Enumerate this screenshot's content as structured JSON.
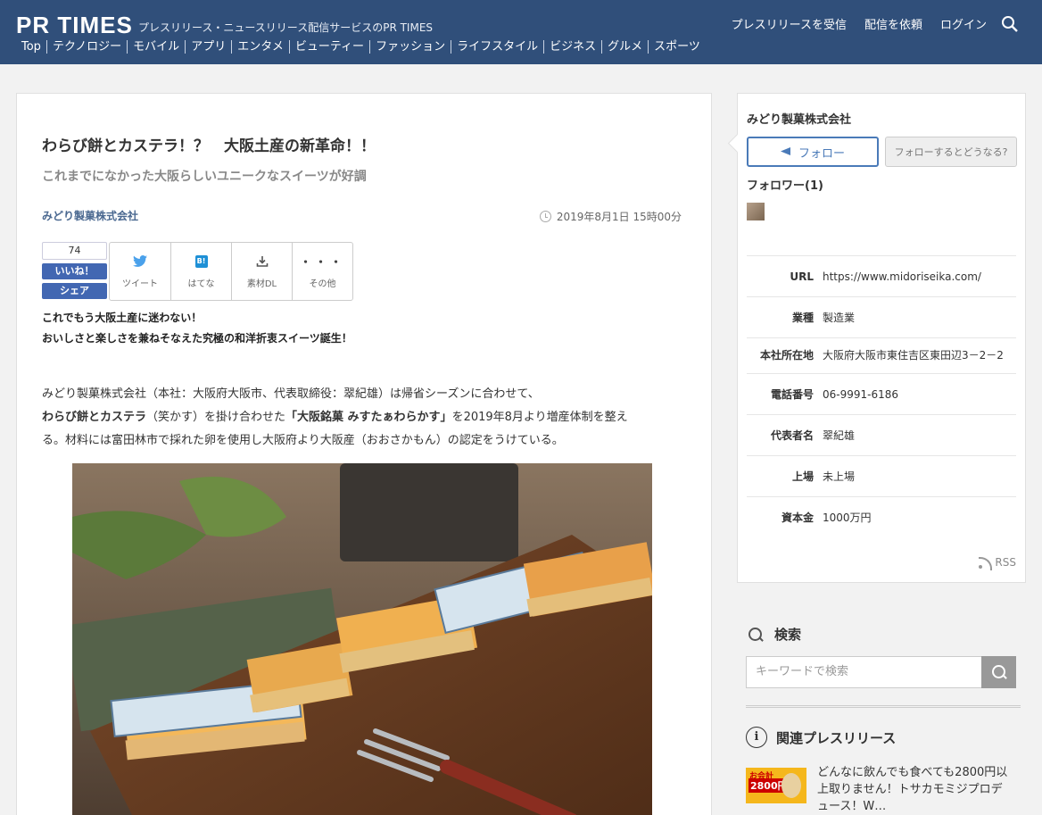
{
  "header": {
    "logo": "PR TIMES",
    "tagline": "プレスリリース・ニュースリリース配信サービスのPR TIMES",
    "links": [
      "プレスリリースを受信",
      "配信を依頼",
      "ログイン"
    ],
    "categories": [
      "Top",
      "テクノロジー",
      "モバイル",
      "アプリ",
      "エンタメ",
      "ビューティー",
      "ファッション",
      "ライフスタイル",
      "ビジネス",
      "グルメ",
      "スポーツ"
    ]
  },
  "article": {
    "title": "わらび餅とカステラ！？　大阪土産の新革命！！",
    "subtitle": "これまでになかった大阪らしいユニークなスイーツが好調",
    "company": "みどり製菓株式会社",
    "date": "2019年8月1日 15時00分",
    "lead1": "これでもう大阪土産に迷わない！",
    "lead2": "おいしさと楽しさを兼ねそなえた究極の和洋折衷スイーツ誕生！",
    "body1": "みどり製菓株式会社（本社：大阪府大阪市、代表取締役：翠紀雄）は帰省シーズンに合わせて、",
    "body2a": "わらび餅とカステラ",
    "body2b": "（笑かす）を掛け合わせた",
    "body2c": "「大阪銘菓 みすたぁわらかす」",
    "body2d": "を2019年8月より増産体制を整え",
    "body3": "る。材料には富田林市で採れた卵を使用し大阪府より大阪産（おおさかもん）の認定をうけている。"
  },
  "share": {
    "fb_count": "74",
    "fb_like": "いいね！",
    "fb_share": "シェア",
    "buttons": [
      {
        "label": "ツイート",
        "icon": "twitter-icon"
      },
      {
        "label": "はてな",
        "icon": "hatena-icon"
      },
      {
        "label": "素材DL",
        "icon": "download-icon"
      },
      {
        "label": "その他",
        "icon": "more-icon"
      }
    ],
    "hatena_glyph": "B!",
    "more_glyph": "・・・"
  },
  "sidebar": {
    "company": "みどり製菓株式会社",
    "follow": "フォロー",
    "follow_help": "フォローするとどうなる?",
    "followers": "フォロワー(1)",
    "info": [
      {
        "k": "URL",
        "v": "https://www.midoriseika.com/"
      },
      {
        "k": "業種",
        "v": "製造業"
      },
      {
        "k": "本社所在地",
        "v": "大阪府大阪市東住吉区東田辺3－2－2"
      },
      {
        "k": "電話番号",
        "v": "06-9991-6186"
      },
      {
        "k": "代表者名",
        "v": "翠紀雄"
      },
      {
        "k": "上場",
        "v": "未上場"
      },
      {
        "k": "資本金",
        "v": "1000万円"
      }
    ],
    "rss": "RSS",
    "search_title": "検索",
    "search_placeholder": "キーワードで検索",
    "related_title": "関連プレスリリース",
    "related_text": "どんなに飲んでも食べても2800円以上取りません！トサカモミジプロデュース！W…",
    "related_thumb_1": "お会計",
    "related_thumb_2": "2800円"
  }
}
